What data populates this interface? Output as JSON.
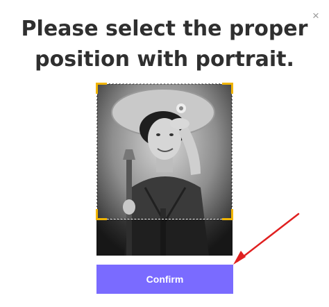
{
  "dialog": {
    "title": "Please select the proper position with portrait.",
    "close_glyph": "×",
    "confirm_label": "Confirm"
  },
  "icons": {
    "close": "close-icon"
  },
  "colors": {
    "accent": "#7a6bff",
    "crop_handle": "#f0b400",
    "annotation_arrow": "#e02020",
    "title_text": "#2f2f2f"
  }
}
